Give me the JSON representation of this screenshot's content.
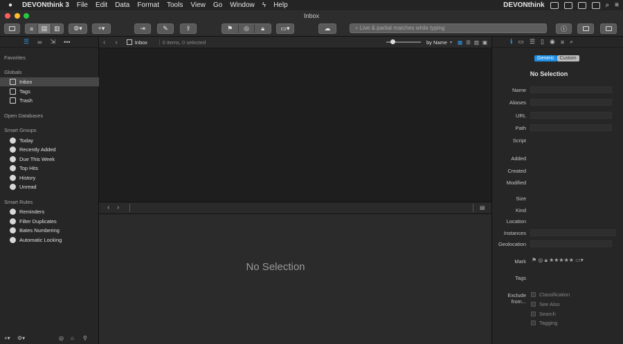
{
  "menubar": {
    "app": "DEVONthink 3",
    "items": [
      "File",
      "Edit",
      "Data",
      "Format",
      "Tools",
      "View",
      "Go",
      "Window",
      "Help"
    ],
    "right_app": "DEVONthink"
  },
  "window": {
    "title": "Inbox"
  },
  "search": {
    "placeholder": "Live & partial matches while typing"
  },
  "sidebar": {
    "sections": {
      "favorites": "Favorites",
      "globals": "Globals",
      "open_databases": "Open Databases",
      "smart_groups": "Smart Groups",
      "smart_rules": "Smart Rules"
    },
    "globals": [
      {
        "label": "Inbox",
        "icon": "inbox-icon"
      },
      {
        "label": "Tags",
        "icon": "tag-icon"
      },
      {
        "label": "Trash",
        "icon": "trash-icon"
      }
    ],
    "smart_groups": [
      {
        "label": "Today",
        "icon": "clock-icon"
      },
      {
        "label": "Recently Added",
        "icon": "clock-icon"
      },
      {
        "label": "Due This Week",
        "icon": "clock-icon"
      },
      {
        "label": "Top Hits",
        "icon": "clock-icon"
      },
      {
        "label": "History",
        "icon": "gear-icon"
      },
      {
        "label": "Unread",
        "icon": "circle-icon"
      }
    ],
    "smart_rules": [
      {
        "label": "Reminders",
        "icon": "clock-icon"
      },
      {
        "label": "Filter Duplicates",
        "icon": "duplicate-icon"
      },
      {
        "label": "Bates Numbering",
        "icon": "duplicate-icon"
      },
      {
        "label": "Automatic Locking",
        "icon": "clock-icon"
      }
    ]
  },
  "listbar": {
    "location": "Inbox",
    "count": "0 items, 0 selected",
    "sort": "by Name"
  },
  "preview": {
    "empty": "No Selection"
  },
  "inspector": {
    "tabs": {
      "generic": "Generic",
      "custom": "Custom"
    },
    "title": "No Selection",
    "fields": [
      "Name",
      "Aliases",
      "URL",
      "Path",
      "Script",
      "Added",
      "Created",
      "Modified",
      "Size",
      "Kind",
      "Location",
      "Instances",
      "Geolocation",
      "Mark",
      "Tags"
    ],
    "exclude_label_1": "Exclude",
    "exclude_label_2": "from...",
    "exclude_options": [
      "Classification",
      "See Also",
      "Search",
      "Tagging"
    ]
  },
  "colors": {
    "accent": "#1f8ee6",
    "close": "#fe5f57",
    "minimize": "#febc2e",
    "zoom": "#28c840"
  }
}
